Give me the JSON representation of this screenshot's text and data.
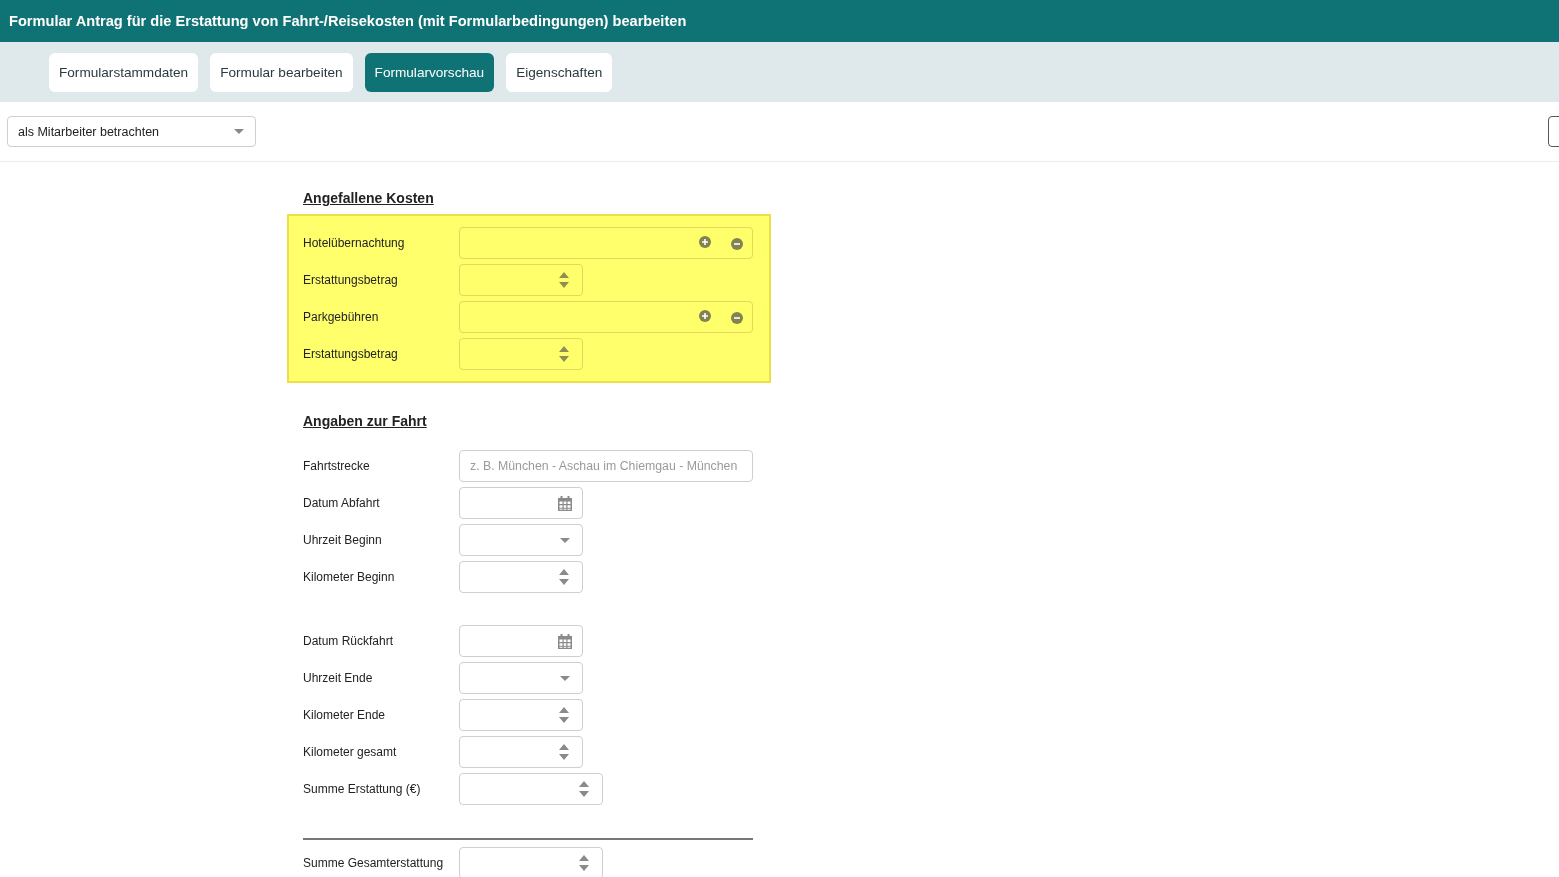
{
  "window": {
    "title": "Formular Antrag für die Erstattung von Fahrt-/Reisekosten (mit Formularbedingungen) bearbeiten"
  },
  "tabs": [
    {
      "label": "Formularstammdaten",
      "selected": false
    },
    {
      "label": "Formular bearbeiten",
      "selected": false
    },
    {
      "label": "Formularvorschau",
      "selected": true
    },
    {
      "label": "Eigenschaften",
      "selected": false
    }
  ],
  "toolbar": {
    "view_as": {
      "value": "als Mitarbeiter betrachten"
    }
  },
  "form": {
    "sections": [
      {
        "heading": "Angefallene Kosten",
        "highlighted": true,
        "groups": [
          {
            "fields": [
              {
                "label": "Hotelübernachtung",
                "kind": "repeatable"
              },
              {
                "label": "Erstattungsbetrag",
                "kind": "number"
              },
              {
                "label": "Parkgebühren",
                "kind": "repeatable"
              },
              {
                "label": "Erstattungsbetrag",
                "kind": "number"
              }
            ]
          }
        ]
      },
      {
        "heading": "Angaben zur Fahrt",
        "highlighted": false,
        "groups": [
          {
            "fields": [
              {
                "label": "Fahrtstrecke",
                "kind": "text",
                "placeholder": "z. B. München - Aschau im Chiemgau - München"
              },
              {
                "label": "Datum Abfahrt",
                "kind": "date"
              },
              {
                "label": "Uhrzeit Beginn",
                "kind": "time"
              },
              {
                "label": "Kilometer Beginn",
                "kind": "number"
              }
            ]
          },
          {
            "fields": [
              {
                "label": "Datum Rückfahrt",
                "kind": "date"
              },
              {
                "label": "Uhrzeit Ende",
                "kind": "time"
              },
              {
                "label": "Kilometer Ende",
                "kind": "number"
              },
              {
                "label": "Kilometer gesamt",
                "kind": "number"
              },
              {
                "label": "Summe Erstattung (€)",
                "kind": "sum"
              }
            ]
          }
        ]
      }
    ],
    "total": {
      "label": "Summe Gesamterstattung",
      "kind": "sum"
    }
  }
}
